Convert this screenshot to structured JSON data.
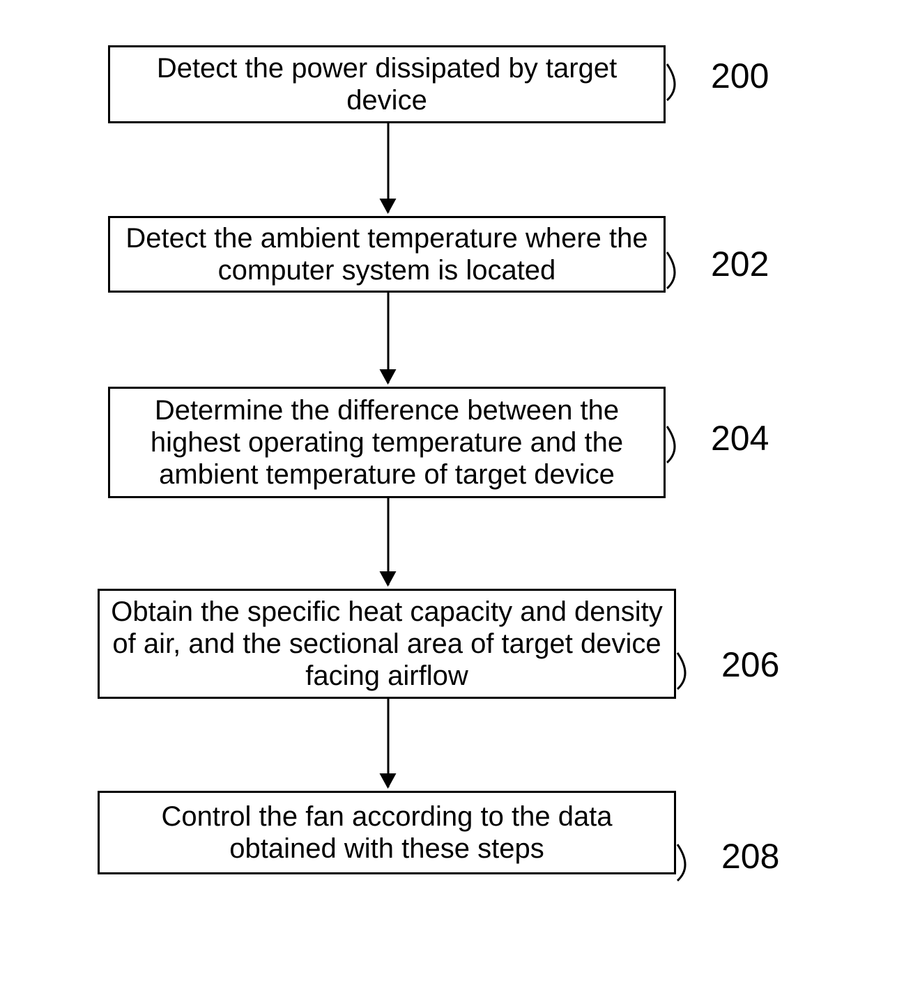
{
  "steps": [
    {
      "text": "Detect the power dissipated by target device",
      "label": "200"
    },
    {
      "text": "Detect the ambient temperature where the computer system is located",
      "label": "202"
    },
    {
      "text": "Determine the difference between the highest operating temperature and the ambient temperature of target device",
      "label": "204"
    },
    {
      "text": "Obtain the specific heat capacity and density of air, and the sectional area of target device facing airflow",
      "label": "206"
    },
    {
      "text": "Control the fan according to the data obtained with these steps",
      "label": "208"
    }
  ]
}
